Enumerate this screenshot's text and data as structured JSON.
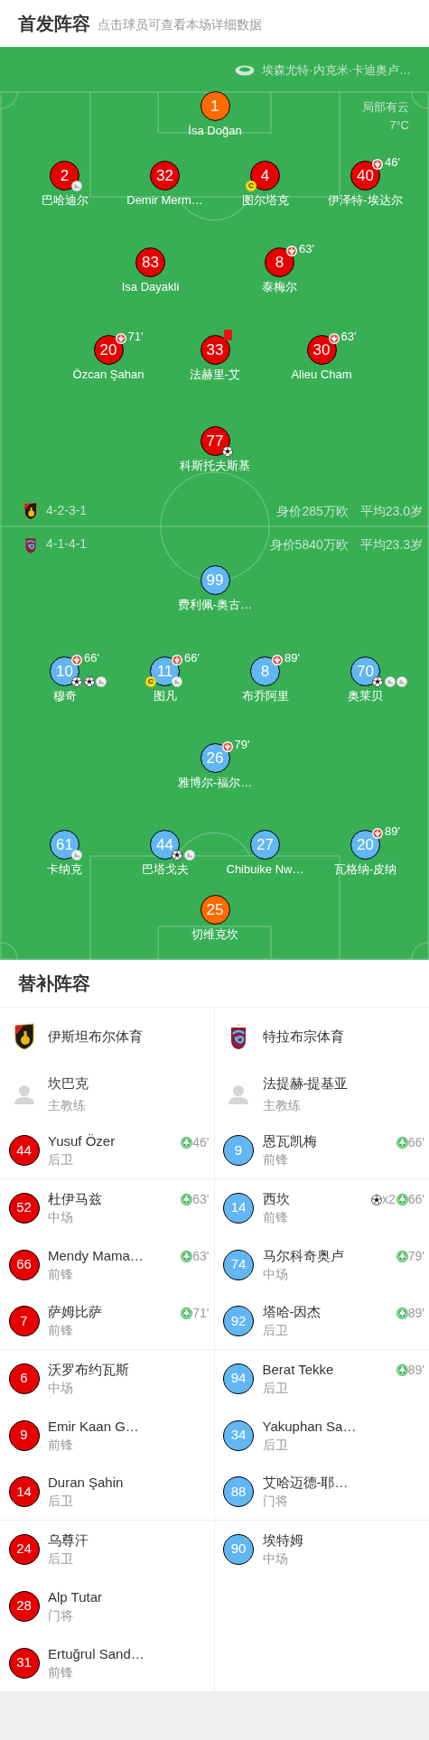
{
  "header": {
    "title": "首发阵容",
    "subtitle": "点击球员可查看本场详细数据"
  },
  "pitch": {
    "venue": "埃森尤特·内克米·卡迪奥卢…",
    "weather": "局部有云",
    "temperature": "7°C",
    "teams": [
      {
        "kind": "home",
        "formation": "4-2-3-1",
        "market_value": "身价285万欧",
        "average_age": "平均23.0岁",
        "goalkeeper": {
          "number": "1",
          "name": "İsa Doğan"
        },
        "lines": [
          [
            {
              "number": "2",
              "name": "巴哈迪尔",
              "events": [
                {
                  "kind": "assist"
                }
              ]
            },
            {
              "number": "32",
              "name": "Demir Merm…"
            },
            {
              "number": "4",
              "name": "图尔塔克",
              "captain_badge": "C"
            },
            {
              "number": "40",
              "name": "伊泽特-埃达尔",
              "sub_off": "46'"
            }
          ],
          [
            {
              "number": "83",
              "name": "Isa Dayakli"
            },
            {
              "number": "8",
              "name": "泰梅尔",
              "sub_off": "63'"
            }
          ],
          [
            {
              "number": "20",
              "name": "Özcan Şahan",
              "sub_off": "71'"
            },
            {
              "number": "33",
              "name": "法赫里-艾",
              "events": [
                {
                  "kind": "red_card"
                }
              ]
            },
            {
              "number": "30",
              "name": "Alieu Cham",
              "sub_off": "63'"
            }
          ],
          [
            {
              "number": "77",
              "name": "科斯托夫斯基",
              "events": [
                {
                  "kind": "goal"
                }
              ]
            }
          ]
        ]
      },
      {
        "kind": "away",
        "formation": "4-1-4-1",
        "market_value": "身价5840万欧",
        "average_age": "平均23.3岁",
        "goalkeeper": {
          "number": "25",
          "name": "切维克坎"
        },
        "lines": [
          [
            {
              "number": "99",
              "name": "费利佩-奥古…"
            }
          ],
          [
            {
              "number": "10",
              "name": "穆奇",
              "sub_off": "66'",
              "events": [
                {
                  "kind": "goal"
                },
                {
                  "kind": "goal"
                },
                {
                  "kind": "assist"
                }
              ]
            },
            {
              "number": "11",
              "name": "图凡",
              "sub_off": "66'",
              "captain_badge": "C",
              "events": [
                {
                  "kind": "assist"
                }
              ]
            },
            {
              "number": "8",
              "name": "布乔阿里",
              "sub_off": "89'"
            },
            {
              "number": "70",
              "name": "奥莱贝",
              "events": [
                {
                  "kind": "goal"
                },
                {
                  "kind": "assist"
                },
                {
                  "kind": "assist"
                }
              ]
            }
          ],
          [
            {
              "number": "26",
              "name": "雅博尔-福尔…",
              "sub_off": "79'"
            }
          ],
          [
            {
              "number": "61",
              "name": "卡纳克",
              "events": [
                {
                  "kind": "assist"
                }
              ]
            },
            {
              "number": "44",
              "name": "巴塔戈夫",
              "events": [
                {
                  "kind": "goal"
                },
                {
                  "kind": "assist"
                }
              ]
            },
            {
              "number": "27",
              "name": "Chibuike Nw…"
            },
            {
              "number": "20",
              "name": "瓦格纳-皮纳",
              "sub_off": "89'"
            }
          ]
        ]
      }
    ]
  },
  "substitutes": {
    "title": "替补阵容",
    "teams": [
      {
        "kind": "home",
        "name": "伊斯坦布尔体育",
        "coach": {
          "name": "坎巴克",
          "role": "主教练"
        },
        "players": [
          {
            "number": "44",
            "name": "Yusuf Özer",
            "position": "后卫",
            "sub_on": "46'"
          },
          {
            "number": "52",
            "name": "杜伊马兹",
            "position": "中场",
            "sub_on": "63'"
          },
          {
            "number": "66",
            "name": "Mendy Mama…",
            "position": "前锋",
            "sub_on": "63'"
          },
          {
            "number": "7",
            "name": "萨姆比萨",
            "position": "前锋",
            "sub_on": "71'"
          },
          {
            "number": "6",
            "name": "沃罗布约瓦斯",
            "position": "中场"
          },
          {
            "number": "9",
            "name": "Emir Kaan G…",
            "position": "前锋"
          },
          {
            "number": "14",
            "name": "Duran Şahin",
            "position": "后卫"
          },
          {
            "number": "24",
            "name": "乌尊汗",
            "position": "后卫"
          },
          {
            "number": "28",
            "name": "Alp Tutar",
            "position": "门将"
          },
          {
            "number": "31",
            "name": "Ertuğrul Sand…",
            "position": "前锋"
          }
        ]
      },
      {
        "kind": "away",
        "name": "特拉布宗体育",
        "coach": {
          "name": "法提赫-提基亚",
          "role": "主教练"
        },
        "players": [
          {
            "number": "9",
            "name": "恩瓦凯梅",
            "position": "前锋",
            "sub_on": "66'"
          },
          {
            "number": "14",
            "name": "西坎",
            "position": "前锋",
            "goals": "x2",
            "sub_on": "66'"
          },
          {
            "number": "74",
            "name": "马尔科奇奥卢",
            "position": "中场",
            "sub_on": "79'"
          },
          {
            "number": "92",
            "name": "塔哈-因杰",
            "position": "后卫",
            "sub_on": "89'"
          },
          {
            "number": "94",
            "name": "Berat Tekke",
            "position": "后卫",
            "sub_on": "89'"
          },
          {
            "number": "34",
            "name": "Yakuphan Sa…",
            "position": "后卫"
          },
          {
            "number": "88",
            "name": "艾哈迈德-耶…",
            "position": "门将"
          },
          {
            "number": "90",
            "name": "埃特姆",
            "position": "中场"
          }
        ]
      }
    ]
  }
}
